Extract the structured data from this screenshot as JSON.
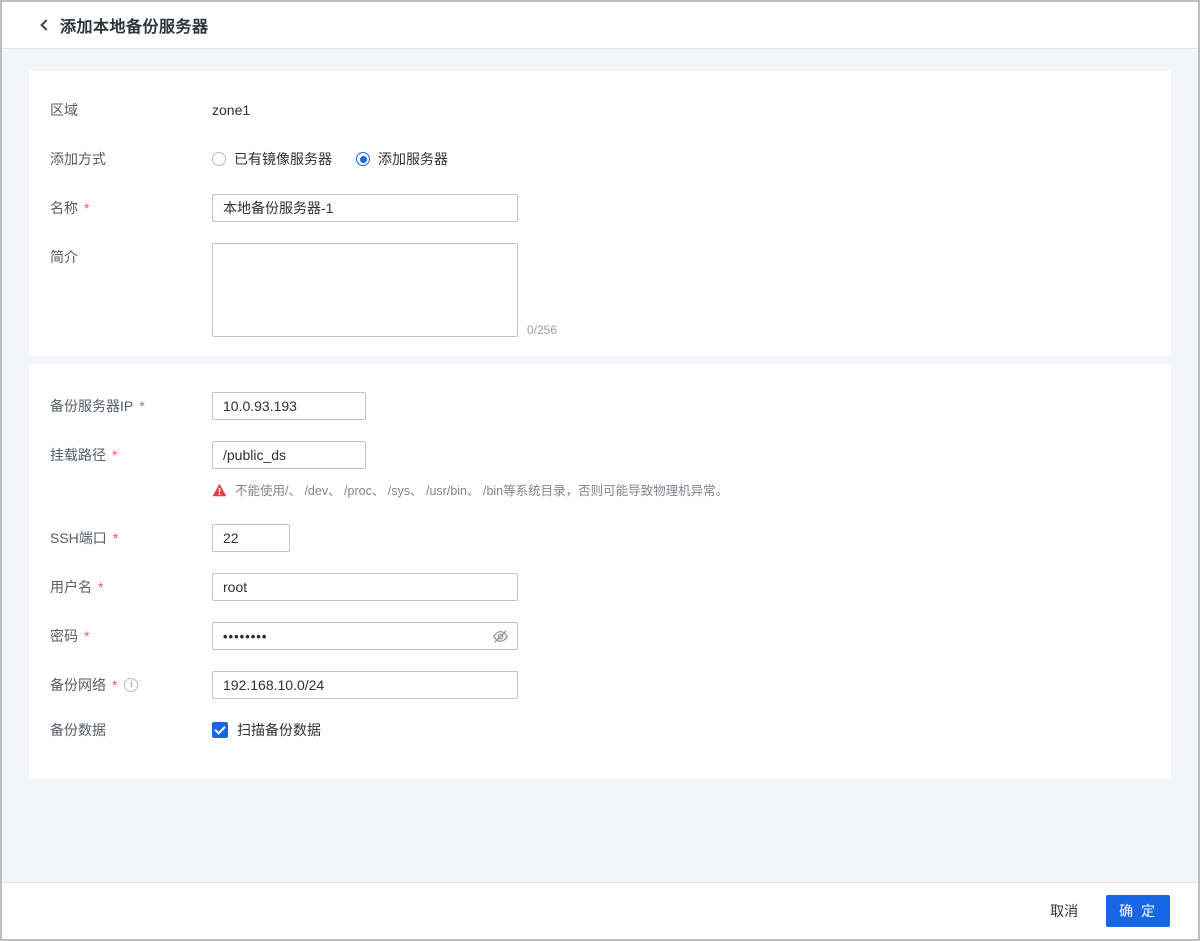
{
  "header": {
    "title": "添加本地备份服务器"
  },
  "icons": {
    "back": "chevron-left",
    "warning": "alert-triangle",
    "info": "i",
    "password_visibility": "eye-off"
  },
  "colors": {
    "primary": "#1766e5",
    "danger": "#e0403f",
    "page_background": "#f3f5f8",
    "card_background": "#ffffff"
  },
  "form": {
    "zone": {
      "label": "区域",
      "value": "zone1"
    },
    "add_mode": {
      "label": "添加方式",
      "options": [
        {
          "label": "已有镜像服务器",
          "selected": false
        },
        {
          "label": "添加服务器",
          "selected": true
        }
      ]
    },
    "name": {
      "label": "名称",
      "required": "*",
      "value": "本地备份服务器-1"
    },
    "description": {
      "label": "简介",
      "value": "",
      "counter": "0/256"
    },
    "server_ip": {
      "label": "备份服务器IP",
      "required": "*",
      "value": "10.0.93.193"
    },
    "mount_path": {
      "label": "挂载路径",
      "required": "*",
      "value": "/public_ds",
      "warning": "不能使用/、 /dev、 /proc、 /sys、 /usr/bin、 /bin等系统目录，否则可能导致物理机异常。"
    },
    "ssh_port": {
      "label": "SSH端口",
      "required": "*",
      "value": "22"
    },
    "username": {
      "label": "用户名",
      "required": "*",
      "value": "root"
    },
    "password": {
      "label": "密码",
      "required": "*",
      "value": "••••••••"
    },
    "backup_network": {
      "label": "备份网络",
      "required": "*",
      "value": "192.168.10.0/24"
    },
    "backup_data": {
      "label": "备份数据",
      "checkbox_label": "扫描备份数据",
      "checked": true
    }
  },
  "footer": {
    "cancel": "取消",
    "confirm": "确 定"
  }
}
